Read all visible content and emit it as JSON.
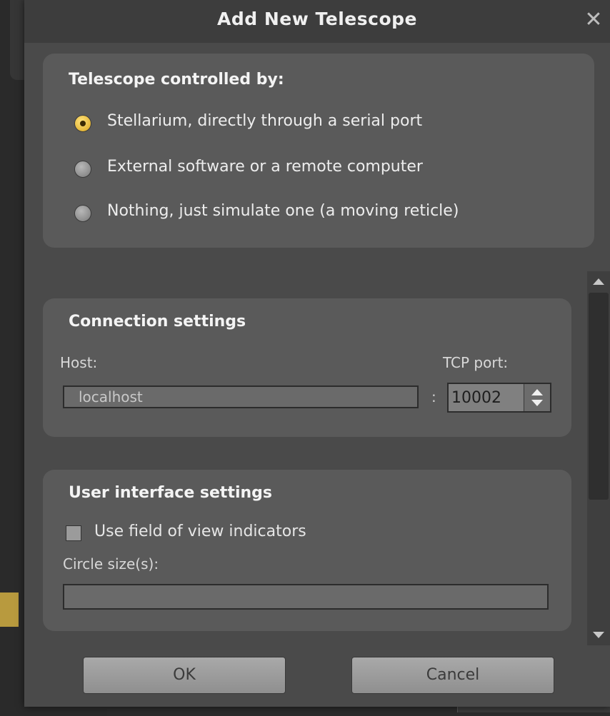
{
  "dialog": {
    "title": "Add New Telescope",
    "close_glyph": "✕"
  },
  "controlled_by": {
    "title": "Telescope controlled by:",
    "options": [
      {
        "label": "Stellarium, directly through a serial port",
        "checked": true
      },
      {
        "label": "External software or a remote computer",
        "checked": false
      },
      {
        "label": "Nothing, just simulate one (a moving reticle)",
        "checked": false
      }
    ]
  },
  "connection": {
    "title": "Connection settings",
    "host_label": "Host:",
    "host_value": "localhost",
    "colon": ":",
    "port_label": "TCP port:",
    "port_value": "10002"
  },
  "ui_settings": {
    "title": "User interface settings",
    "fov_checkbox_label": "Use field of view indicators",
    "fov_checked": false,
    "circle_label": "Circle size(s):",
    "circle_value": ""
  },
  "buttons": {
    "ok": "OK",
    "cancel": "Cancel"
  },
  "colors": {
    "dialog_bg": "#4a4a4a",
    "group_bg": "#5a5a5a",
    "radio_checked": "#e0b030",
    "text": "#e6e6e6"
  },
  "icons": {
    "close": "close-icon",
    "radio_selected": "radio-selected-icon",
    "scroll_up": "scroll-up-icon",
    "scroll_down": "scroll-down-icon",
    "spin_up": "spin-up-icon",
    "spin_down": "spin-down-icon"
  }
}
